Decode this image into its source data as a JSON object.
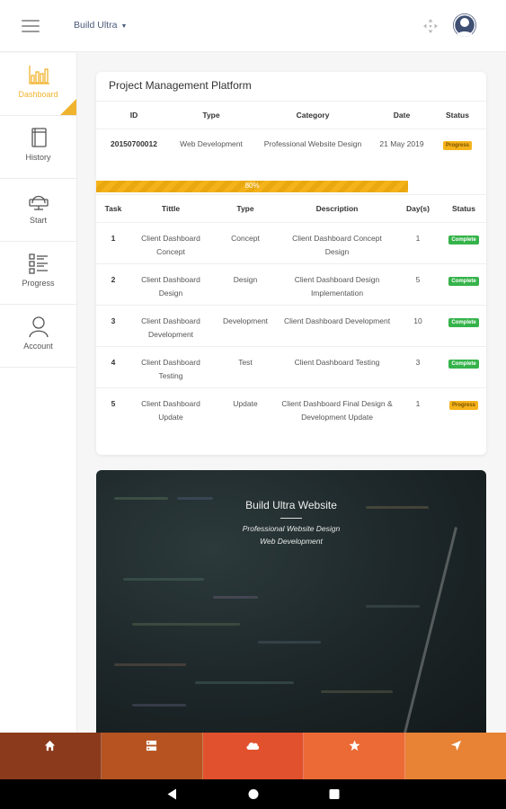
{
  "topbar": {
    "brand": "Build Ultra",
    "caret": "▼"
  },
  "sidebar": {
    "items": [
      {
        "label": "Dashboard",
        "icon": "bar-chart-icon",
        "active": true
      },
      {
        "label": "History",
        "icon": "book-icon"
      },
      {
        "label": "Start",
        "icon": "desktop-icon"
      },
      {
        "label": "Progress",
        "icon": "checklist-icon"
      },
      {
        "label": "Account",
        "icon": "user-icon"
      }
    ]
  },
  "project": {
    "title": "Project Management Platform",
    "headers": [
      "ID",
      "Type",
      "Category",
      "Date",
      "Status"
    ],
    "row": {
      "id": "20150700012",
      "type": "Web Development",
      "category": "Professional Website Design",
      "date": "21 May 2019",
      "status": "Progress"
    },
    "progress_label": "80%",
    "progress_value": 0.8
  },
  "tasks": {
    "headers": [
      "Task",
      "Tittle",
      "Type",
      "Description",
      "Day(s)",
      "Status"
    ],
    "rows": [
      {
        "task": "1",
        "title": "Client Dashboard Concept",
        "type": "Concept",
        "description": "Client Dashboard Concept Design",
        "days": "1",
        "status": "Complete"
      },
      {
        "task": "2",
        "title": "Client Dashboard Design",
        "type": "Design",
        "description": "Client Dashboard Design Implementation",
        "days": "5",
        "status": "Complete"
      },
      {
        "task": "3",
        "title": "Client Dashboard Development",
        "type": "Development",
        "description": "Client Dashboard Development",
        "days": "10",
        "status": "Complete"
      },
      {
        "task": "4",
        "title": "Client Dashboard Testing",
        "type": "Test",
        "description": "Client Dashboard Testing",
        "days": "3",
        "status": "Complete"
      },
      {
        "task": "5",
        "title": "Client Dashboard Update",
        "type": "Update",
        "description": "Client Dashboard Final Design & Development Update",
        "days": "1",
        "status": "Progress"
      }
    ]
  },
  "hero": {
    "title": "Build Ultra Website",
    "subtitle_1": "Professional Website Design",
    "subtitle_2": "Web Development"
  },
  "bottom_nav": [
    {
      "icon": "home-icon",
      "color": "#8b3a1b"
    },
    {
      "icon": "server-icon",
      "color": "#b65320"
    },
    {
      "icon": "cloud-icon",
      "color": "#e1512d"
    },
    {
      "icon": "star-icon",
      "color": "#eb6a35"
    },
    {
      "icon": "navigation-icon",
      "color": "#e88234"
    }
  ],
  "colors": {
    "accent": "#f0b32e",
    "complete": "#35b34a",
    "progress": "#f5b31b"
  }
}
